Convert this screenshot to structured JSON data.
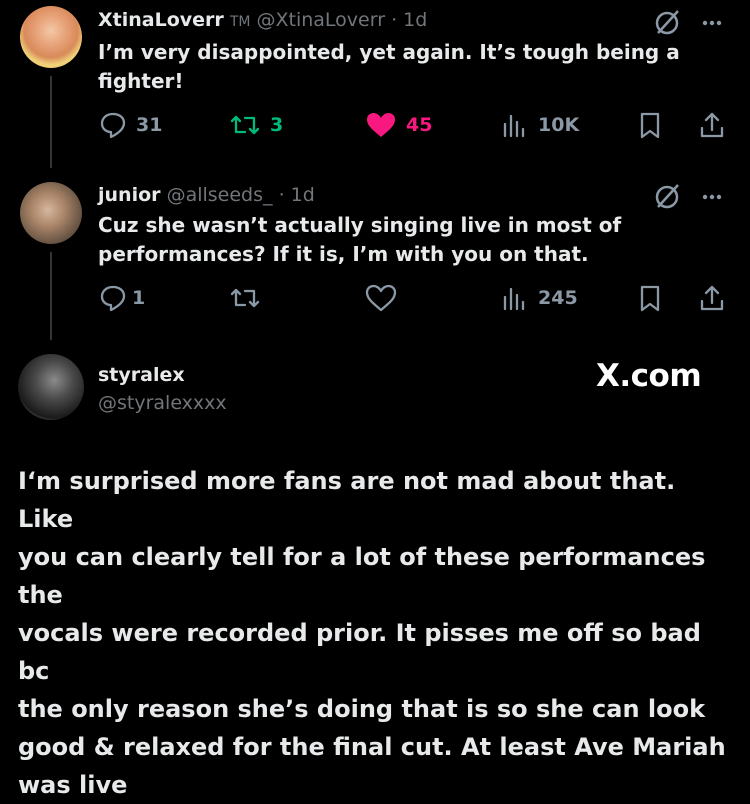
{
  "tweets": [
    {
      "display_name": "XtinaLoverr",
      "badge": "TM",
      "handle": "@XtinaLoverr",
      "time": "· 1d",
      "text_line1": "I’m very disappointed, yet again. It’s tough being a",
      "text_line2": "fighter!",
      "replies": "31",
      "reposts": "3",
      "likes": "45",
      "views": "10K",
      "liked": true,
      "reposted": true
    },
    {
      "display_name": "junior",
      "handle": "@allseeds_",
      "time": "· 1d",
      "text_line1": "Cuz she wasn’t actually singing live in most of",
      "text_line2": "performances? If it is, I’m with you on that.",
      "replies": "1",
      "views": "245"
    }
  ],
  "reply": {
    "display_name": "styralex",
    "handle": "@styralexxxx",
    "site_label": "X.com",
    "text": [
      "I‘m surprised more fans are not mad about that. Like",
      "you can clearly tell for a lot of these performances the",
      "vocals were recorded prior. It pisses me off so bad bc",
      "the only reason she’s doing that is so she can look",
      "good & relaxed for the final cut. At least Ave Mariah",
      "was live"
    ]
  },
  "colors": {
    "background": "#000000",
    "text": "#e7e9ea",
    "muted": "#71767b",
    "repost_green": "#00ba7c",
    "like_pink": "#f91880"
  },
  "icons": [
    "reply-icon",
    "repost-icon",
    "heart-icon",
    "views-icon",
    "bookmark-icon",
    "share-icon",
    "grok-icon",
    "more-icon"
  ]
}
